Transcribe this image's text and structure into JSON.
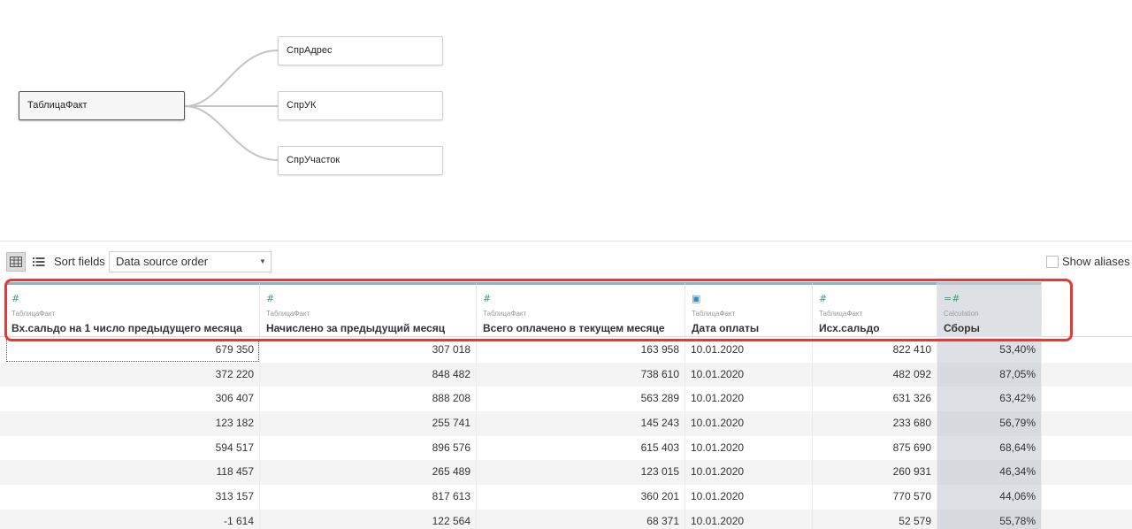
{
  "canvas": {
    "primary_table": "ТаблицаФакт",
    "related_tables": [
      "СпрАдрес",
      "СпрУК",
      "СпрУчасток"
    ]
  },
  "toolbar": {
    "sort_label": "Sort fields",
    "sort_value": "Data source order",
    "show_aliases_label": "Show aliases",
    "icons": [
      "grid-view-icon",
      "list-view-icon",
      "chevron-down-icon"
    ]
  },
  "columns": [
    {
      "icon": "number-icon",
      "icon_glyph": "#",
      "source": "ТаблицаФакт",
      "name": "Вх.сальдо на   1 число предыдущего месяца"
    },
    {
      "icon": "number-icon",
      "icon_glyph": "#",
      "source": "ТаблицаФакт",
      "name": "Начислено за предыдущий месяц"
    },
    {
      "icon": "number-icon",
      "icon_glyph": "#",
      "source": "ТаблицаФакт",
      "name": "Всего оплачено в текущем месяце"
    },
    {
      "icon": "calendar-icon",
      "icon_glyph": "▣",
      "source": "ТаблицаФакт",
      "name": "Дата оплаты"
    },
    {
      "icon": "number-icon",
      "icon_glyph": "#",
      "source": "ТаблицаФакт",
      "name": "Исх.сальдо"
    },
    {
      "icon": "calculated-number-icon",
      "icon_glyph": "=#",
      "source": "Calculation",
      "name": "Сборы"
    }
  ],
  "rows": [
    [
      "679 350",
      "307 018",
      "163 958",
      "10.01.2020",
      "822 410",
      "53,40%"
    ],
    [
      "372 220",
      "848 482",
      "738 610",
      "10.01.2020",
      "482 092",
      "87,05%"
    ],
    [
      "306 407",
      "888 208",
      "563 289",
      "10.01.2020",
      "631 326",
      "63,42%"
    ],
    [
      "123 182",
      "255 741",
      "145 243",
      "10.01.2020",
      "233 680",
      "56,79%"
    ],
    [
      "594 517",
      "896 576",
      "615 403",
      "10.01.2020",
      "875 690",
      "68,64%"
    ],
    [
      "118 457",
      "265 489",
      "123 015",
      "10.01.2020",
      "260 931",
      "46,34%"
    ],
    [
      "313 157",
      "817 613",
      "360 201",
      "10.01.2020",
      "770 570",
      "44,06%"
    ],
    [
      "-1 614",
      "122 564",
      "68 371",
      "10.01.2020",
      "52 579",
      "55,78%"
    ]
  ],
  "colors": {
    "highlight": "#e23a36",
    "column_top_border": "#8fb3c8",
    "calc_column_bg": "#dde1e5",
    "number_icon": "#3aa37a",
    "date_icon": "#3a8bbf"
  }
}
